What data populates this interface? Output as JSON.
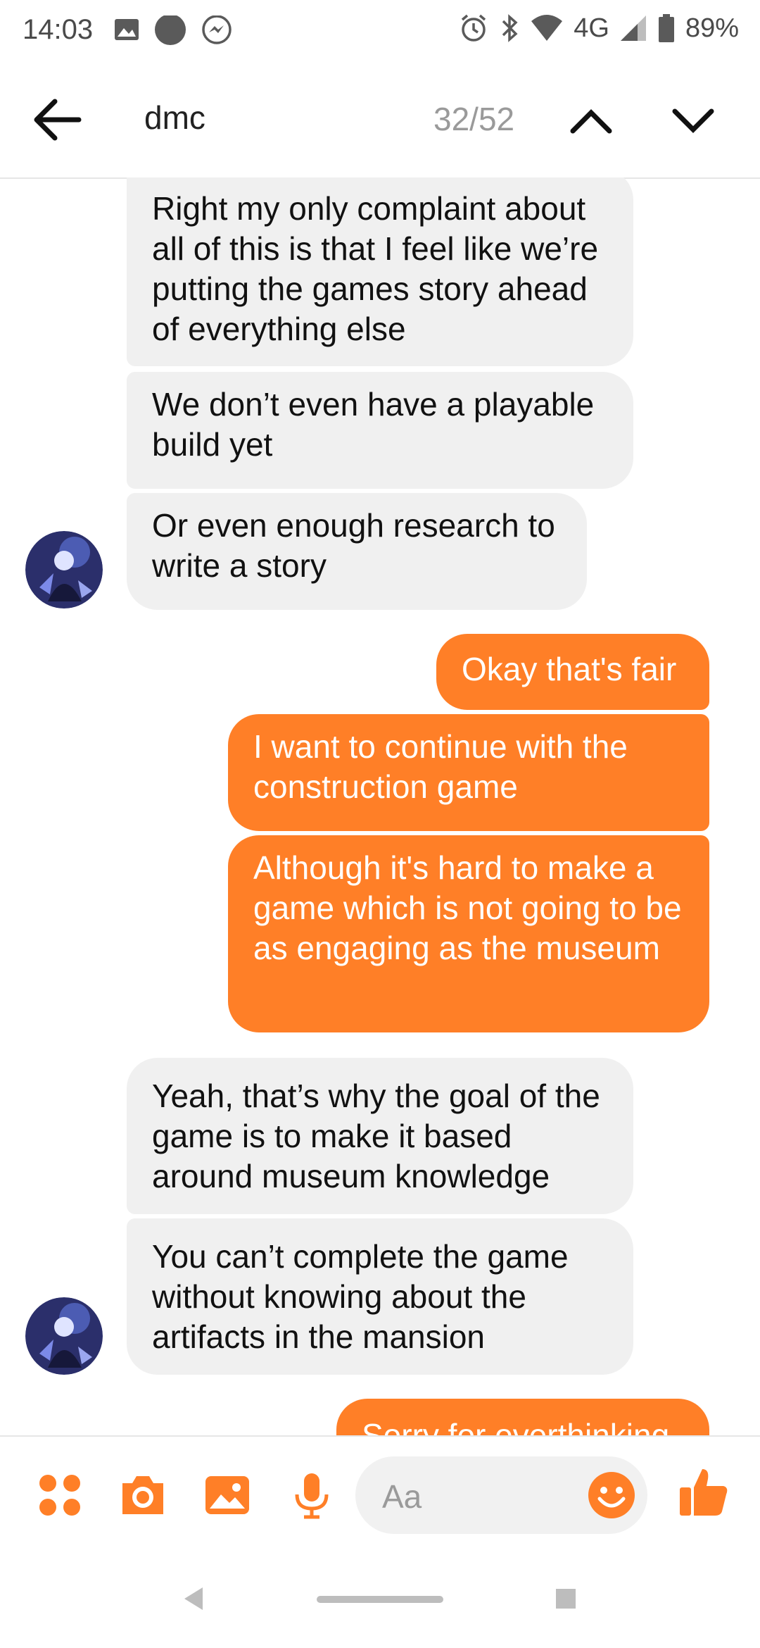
{
  "status_bar": {
    "time": "14:03",
    "network": "4G",
    "battery": "89%"
  },
  "header": {
    "search_term": "dmc",
    "match_counter": "32/52"
  },
  "messages": [
    {
      "side": "in",
      "text": "Right my only complaint about all of this is that I feel like we’re putting the games story ahead of everything else"
    },
    {
      "side": "in",
      "text": "We don’t even have a playable build yet"
    },
    {
      "side": "in",
      "text": "Or even enough research to write a story"
    },
    {
      "side": "out",
      "text": "Okay that's fair"
    },
    {
      "side": "out",
      "text": "I want to continue with the construction game"
    },
    {
      "side": "out",
      "text": "Although it's hard to make a game which is not going to be as engaging as the museum"
    },
    {
      "side": "in",
      "text": "Yeah, that’s why the goal of the game is to make it based around museum knowledge"
    },
    {
      "side": "in",
      "text": "You can’t complete the game without knowing about the artifacts in the mansion"
    },
    {
      "side": "out",
      "text": "Sorry for overthinking"
    }
  ],
  "composer": {
    "placeholder": "Aa",
    "icons": [
      "menu-dots-icon",
      "camera-icon",
      "gallery-icon",
      "microphone-icon",
      "smiley-icon",
      "thumbs-up-icon"
    ]
  },
  "colors": {
    "accent": "#ff7f27",
    "incoming_bubble": "#f0f0f0"
  }
}
